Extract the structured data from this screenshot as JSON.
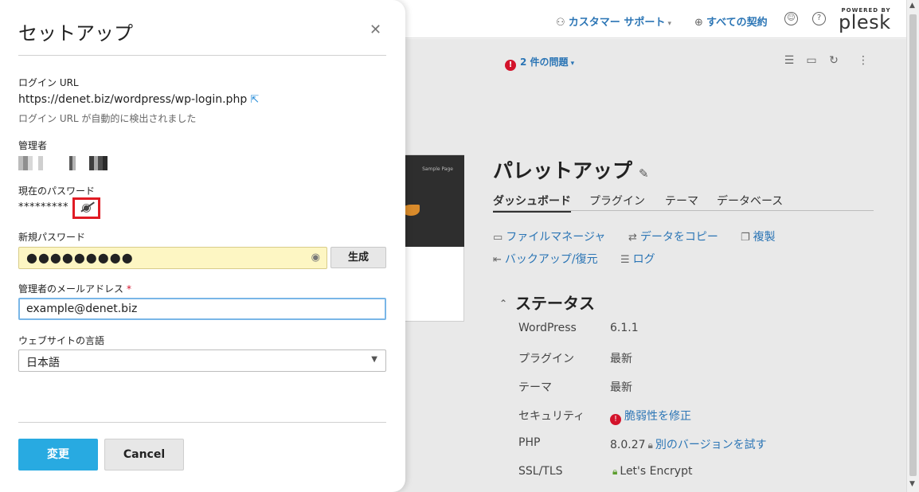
{
  "header": {
    "customer_support": "カスタマー サポート",
    "all_subscriptions": "すべての契約",
    "plesk_powered": "POWERED BY",
    "plesk_name": "plesk"
  },
  "toolbar": {
    "issues_count": "!",
    "issues_label": "2 件の問題"
  },
  "site": {
    "thumbnail_label": "Sample Page",
    "title": "パレットアップ",
    "tabs": [
      "ダッシュボード",
      "プラグイン",
      "テーマ",
      "データベース"
    ],
    "actions": {
      "file_manager": "ファイルマネージャ",
      "copy_data": "データをコピー",
      "clone": "複製",
      "backup": "バックアップ/復元",
      "log": "ログ"
    },
    "status_heading": "ステータス",
    "status": [
      {
        "label": "WordPress",
        "value": "6.1.1"
      },
      {
        "label": "プラグイン",
        "value": "最新"
      },
      {
        "label": "テーマ",
        "value": "最新"
      },
      {
        "label": "セキュリティ",
        "value": "脆弱性を修正"
      },
      {
        "label": "PHP",
        "value": "8.0.27",
        "link": "別のバージョンを試す"
      },
      {
        "label": "SSL/TLS",
        "value": "Let's Encrypt"
      }
    ]
  },
  "modal": {
    "title": "セットアップ",
    "login_url_label": "ログイン URL",
    "login_url": "https://denet.biz/wordpress/wp-login.php",
    "login_url_hint": "ログイン URL が自動的に検出されました",
    "admin_label": "管理者",
    "current_password_label": "現在のパスワード",
    "current_password_masked": "*********",
    "new_password_label": "新規パスワード",
    "new_password_masked": "●●●●●●●●●",
    "generate_label": "生成",
    "admin_email_label": "管理者のメールアドレス",
    "required_mark": "*",
    "admin_email_value": "example@denet.biz",
    "language_label": "ウェブサイトの言語",
    "language_value": "日本語",
    "submit_label": "変更",
    "cancel_label": "Cancel"
  },
  "colors": {
    "primary": "#28aae1",
    "link": "#2b75b5",
    "danger": "#d3132b",
    "highlight": "#e01b24"
  }
}
